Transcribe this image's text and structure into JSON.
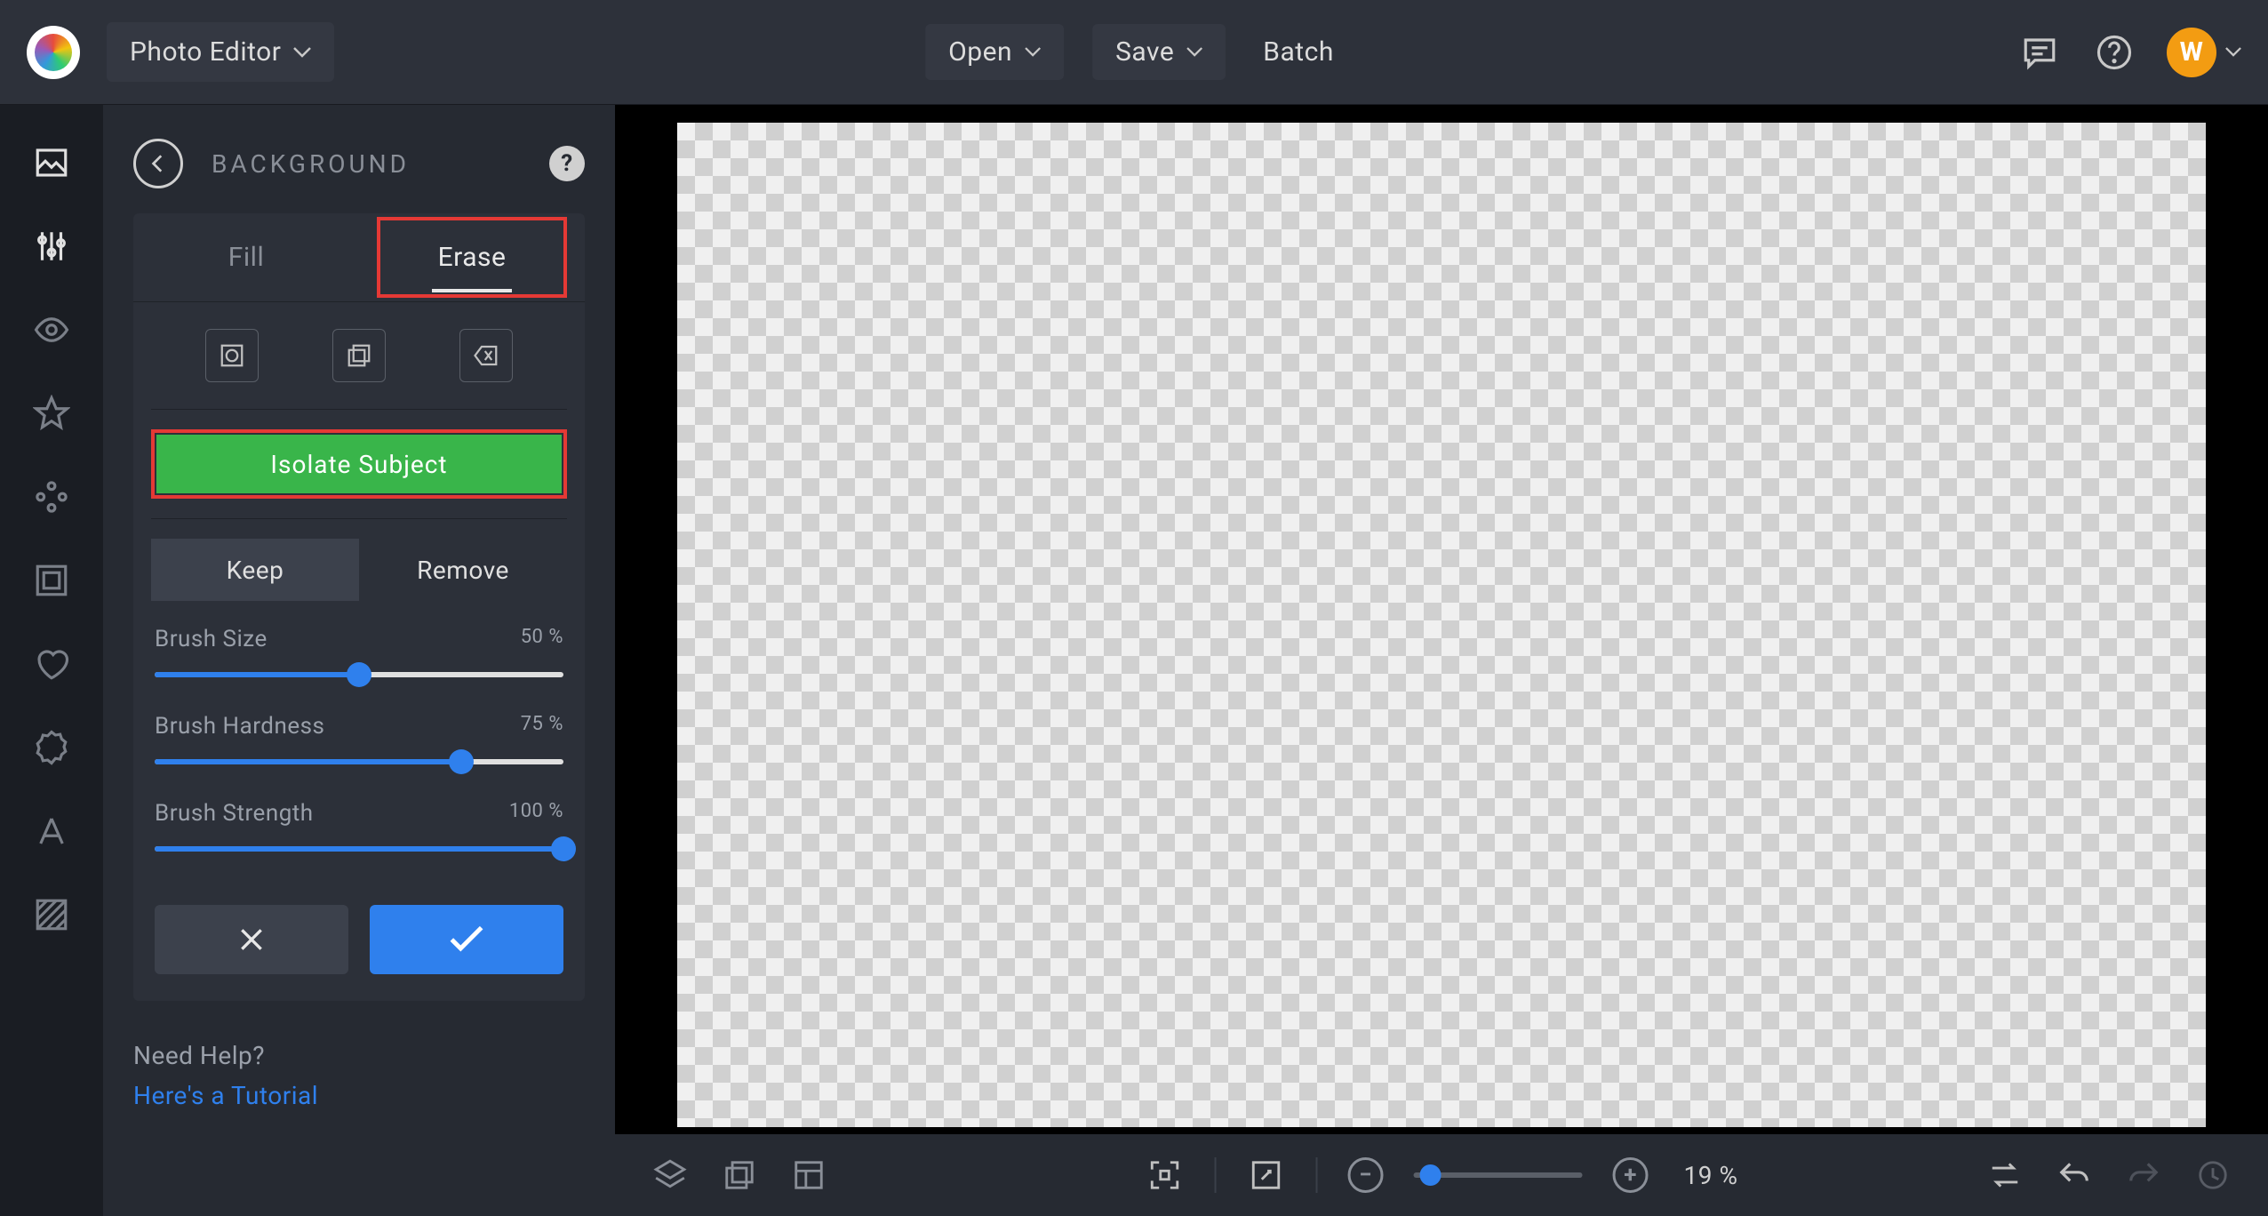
{
  "header": {
    "app_title": "Photo Editor",
    "open_label": "Open",
    "save_label": "Save",
    "batch_label": "Batch",
    "avatar_initial": "W"
  },
  "panel": {
    "title": "BACKGROUND",
    "tabs": {
      "fill": "Fill",
      "erase": "Erase"
    },
    "isolate_label": "Isolate Subject",
    "keep_label": "Keep",
    "remove_label": "Remove",
    "sliders": {
      "brush_size": {
        "label": "Brush Size",
        "value": "50 %",
        "percent": 50
      },
      "brush_hardness": {
        "label": "Brush Hardness",
        "value": "75 %",
        "percent": 75
      },
      "brush_strength": {
        "label": "Brush Strength",
        "value": "100 %",
        "percent": 100
      }
    },
    "help_question": "Need Help?",
    "help_link": "Here's a Tutorial"
  },
  "bottombar": {
    "zoom_label": "19 %"
  },
  "colors": {
    "accent": "#2f80ed",
    "green": "#39b54a",
    "annotation": "#e53935"
  }
}
